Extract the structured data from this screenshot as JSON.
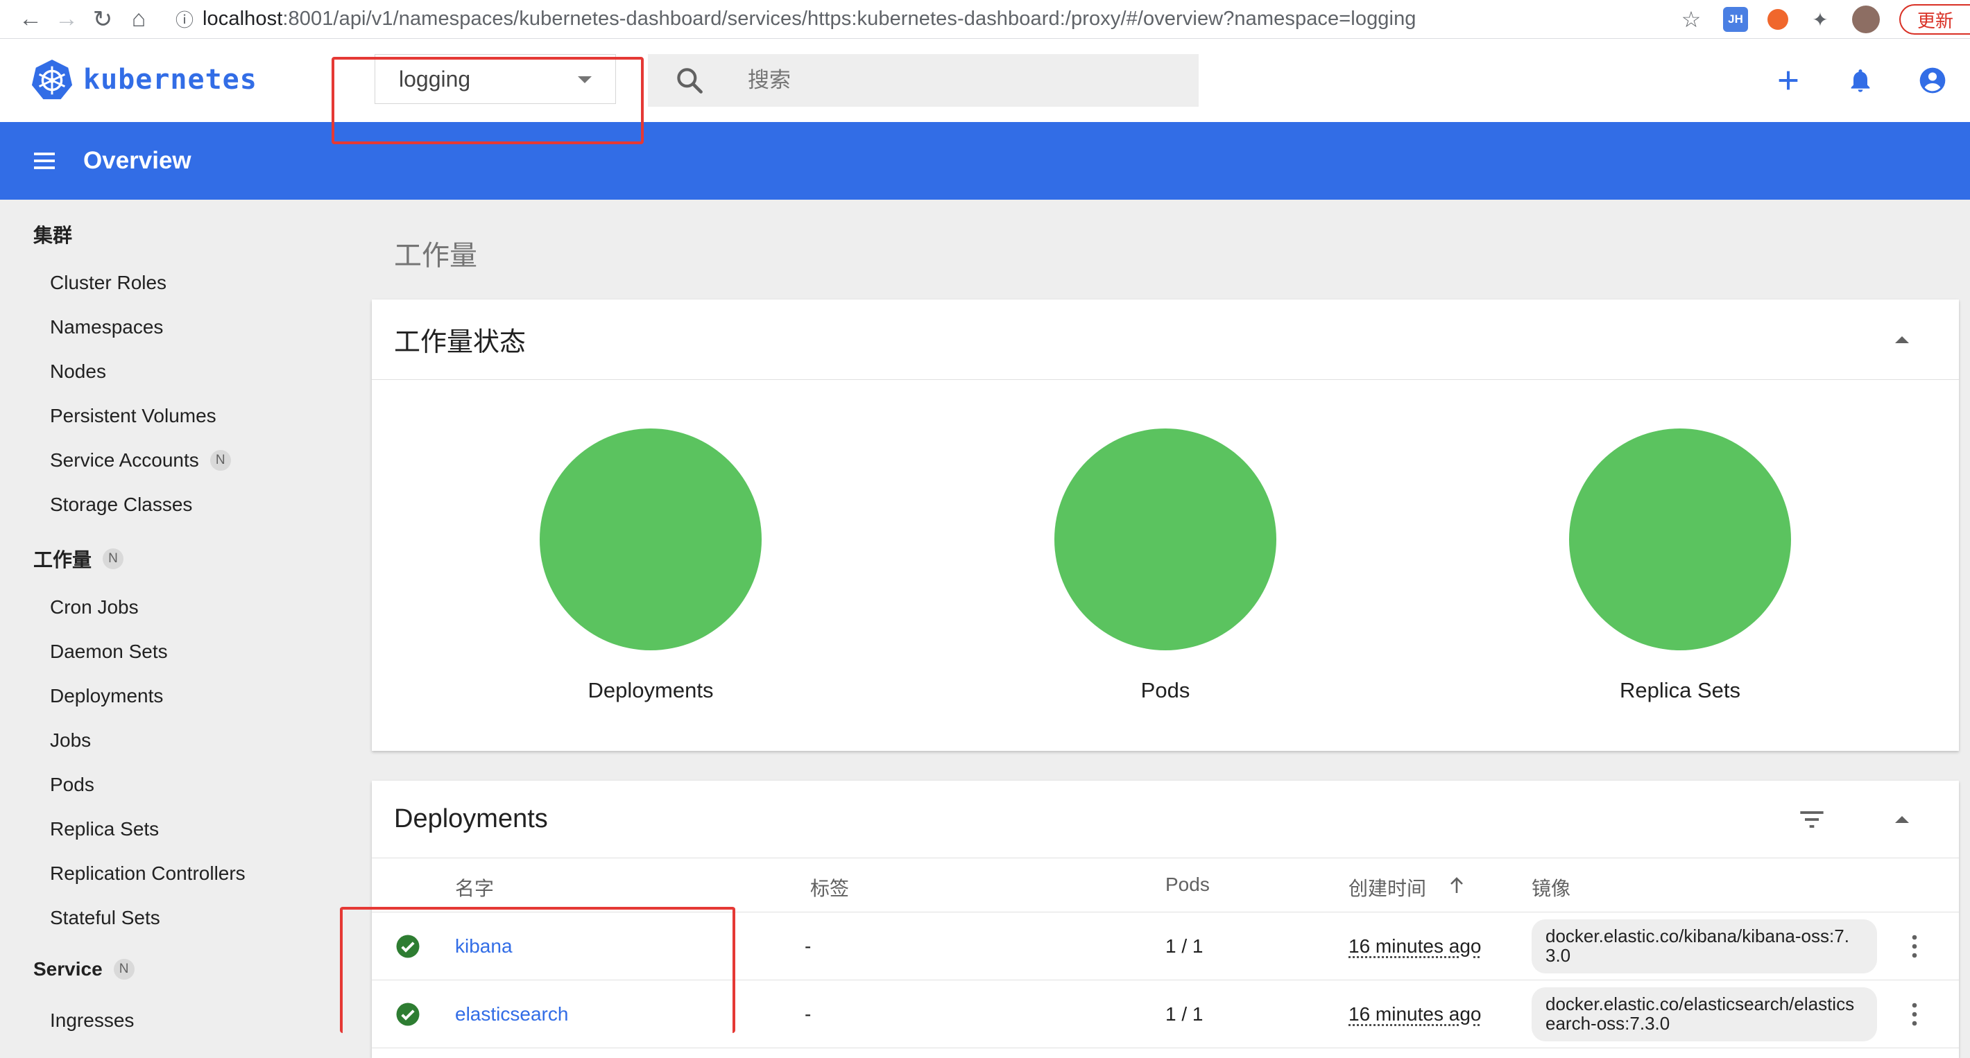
{
  "browser": {
    "url_host": "localhost",
    "url_rest": ":8001/api/v1/namespaces/kubernetes-dashboard/services/https:kubernetes-dashboard:/proxy/#/overview?namespace=logging",
    "update_label": "更新",
    "ext_jh_label": "JH"
  },
  "app": {
    "brand": "kubernetes",
    "namespace": "logging",
    "search_placeholder": "搜索",
    "page_title": "Overview"
  },
  "sidebar": {
    "cluster_group": "集群",
    "cluster_items": [
      "Cluster Roles",
      "Namespaces",
      "Nodes",
      "Persistent Volumes",
      "Service Accounts",
      "Storage Classes"
    ],
    "workloads_group": "工作量",
    "workload_items": [
      "Cron Jobs",
      "Daemon Sets",
      "Deployments",
      "Jobs",
      "Pods",
      "Replica Sets",
      "Replication Controllers",
      "Stateful Sets"
    ],
    "service_group": "Service",
    "service_items": [
      "Ingresses"
    ],
    "badge": "N"
  },
  "main": {
    "section_title": "工作量",
    "status_card": {
      "title": "工作量状态",
      "items": [
        "Deployments",
        "Pods",
        "Replica Sets"
      ],
      "status_color": "#5bc35f"
    },
    "deployments_card": {
      "title": "Deployments",
      "columns": [
        "名字",
        "标签",
        "Pods",
        "创建时间",
        "镜像"
      ],
      "rows": [
        {
          "name": "kibana",
          "labels": "-",
          "pods": "1 / 1",
          "created": "16 minutes ago",
          "image": "docker.elastic.co/kibana/kibana-oss:7.3.0"
        },
        {
          "name": "elasticsearch",
          "labels": "-",
          "pods": "1 / 1",
          "created": "16 minutes ago",
          "image": "docker.elastic.co/elasticsearch/elasticsearch-oss:7.3.0"
        }
      ]
    }
  },
  "colors": {
    "accent": "#326de6",
    "ok": "#5bc35f",
    "ok_icon": "#2e7d32",
    "highlight": "#e53935"
  }
}
